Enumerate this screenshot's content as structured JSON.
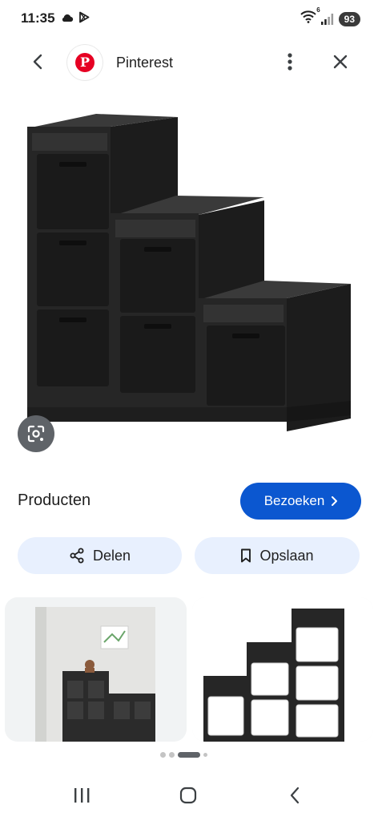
{
  "status_bar": {
    "time": "11:35",
    "left_icons": [
      "cloud-icon",
      "play-store-icon"
    ],
    "right_icons": [
      "wifi-icon",
      "signal-icon"
    ],
    "wifi_badge": "6",
    "battery": "93"
  },
  "top_bar": {
    "site_title": "Pinterest",
    "logo_letter": "P"
  },
  "actions": {
    "products_label": "Producten",
    "visit_label": "Bezoeken",
    "share_label": "Delen",
    "save_label": "Opslaan"
  },
  "pager": {
    "count": 4,
    "active_index": 2
  },
  "colors": {
    "accent": "#0b57d0",
    "chip_bg": "#e8f0fe",
    "pinterest_red": "#e60023",
    "furniture": "#2a2a2a"
  }
}
